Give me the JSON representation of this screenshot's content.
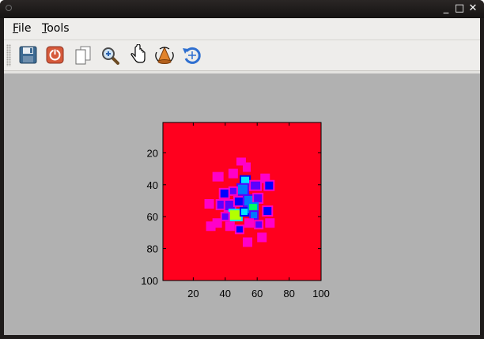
{
  "window": {
    "minimize_glyph": "_",
    "maximize_glyph": "□",
    "close_glyph": "✕"
  },
  "menubar": {
    "file": {
      "mnemonic": "F",
      "rest": "ile"
    },
    "tools": {
      "mnemonic": "T",
      "rest": "ools"
    }
  },
  "toolbar": {
    "buttons": [
      {
        "name": "save",
        "icon": "floppy-disk-icon"
      },
      {
        "name": "stop",
        "icon": "power-stop-icon"
      },
      {
        "name": "copy",
        "icon": "copy-pages-icon"
      },
      {
        "name": "zoom",
        "icon": "magnifier-icon"
      },
      {
        "name": "pan",
        "icon": "hand-pointer-icon"
      },
      {
        "name": "rotate",
        "icon": "rotate-3d-cone-icon"
      },
      {
        "name": "reset",
        "icon": "undo-arrow-icon"
      }
    ]
  },
  "chart_data": {
    "type": "heatmap",
    "title": "",
    "xlabel": "",
    "ylabel": "",
    "xlim": [
      1,
      100
    ],
    "ylim": [
      1,
      100
    ],
    "y_reversed": true,
    "x_ticks": [
      "20",
      "40",
      "60",
      "80",
      "100"
    ],
    "y_ticks": [
      "20",
      "40",
      "60",
      "80",
      "100"
    ],
    "x_tick_values": [
      20,
      40,
      60,
      80,
      100
    ],
    "y_tick_values": [
      20,
      40,
      60,
      80,
      100
    ],
    "background_color": "#ff001e",
    "colormap": [
      "#ff001e",
      "#ff00c8",
      "#5a00ff",
      "#0000ff",
      "#0078ff",
      "#00e6ff",
      "#00ff64",
      "#b4ff00"
    ],
    "blobs": [
      {
        "x": 48,
        "y": 24,
        "w": 4,
        "h": 3,
        "level": 1
      },
      {
        "x": 52,
        "y": 27,
        "w": 3,
        "h": 4,
        "level": 1
      },
      {
        "x": 33,
        "y": 33,
        "w": 5,
        "h": 4,
        "level": 1
      },
      {
        "x": 43,
        "y": 31,
        "w": 4,
        "h": 4,
        "level": 1
      },
      {
        "x": 50,
        "y": 35,
        "w": 5,
        "h": 5,
        "level": 5
      },
      {
        "x": 48,
        "y": 40,
        "w": 6,
        "h": 6,
        "level": 4
      },
      {
        "x": 43,
        "y": 42,
        "w": 4,
        "h": 4,
        "level": 2
      },
      {
        "x": 37,
        "y": 43,
        "w": 5,
        "h": 5,
        "level": 3
      },
      {
        "x": 56,
        "y": 38,
        "w": 6,
        "h": 5,
        "level": 2
      },
      {
        "x": 63,
        "y": 34,
        "w": 4,
        "h": 4,
        "level": 1
      },
      {
        "x": 65,
        "y": 38,
        "w": 5,
        "h": 5,
        "level": 3
      },
      {
        "x": 35,
        "y": 50,
        "w": 5,
        "h": 5,
        "level": 2
      },
      {
        "x": 40,
        "y": 50,
        "w": 6,
        "h": 6,
        "level": 2
      },
      {
        "x": 46,
        "y": 48,
        "w": 5,
        "h": 5,
        "level": 3
      },
      {
        "x": 52,
        "y": 47,
        "w": 6,
        "h": 6,
        "level": 4
      },
      {
        "x": 58,
        "y": 46,
        "w": 5,
        "h": 5,
        "level": 2
      },
      {
        "x": 28,
        "y": 50,
        "w": 4,
        "h": 4,
        "level": 1
      },
      {
        "x": 43,
        "y": 56,
        "w": 7,
        "h": 6,
        "level": 7
      },
      {
        "x": 50,
        "y": 55,
        "w": 4,
        "h": 4,
        "level": 5
      },
      {
        "x": 55,
        "y": 52,
        "w": 5,
        "h": 5,
        "level": 6
      },
      {
        "x": 56,
        "y": 57,
        "w": 4,
        "h": 4,
        "level": 4
      },
      {
        "x": 64,
        "y": 54,
        "w": 5,
        "h": 5,
        "level": 3
      },
      {
        "x": 38,
        "y": 58,
        "w": 4,
        "h": 4,
        "level": 2
      },
      {
        "x": 33,
        "y": 62,
        "w": 4,
        "h": 4,
        "level": 1
      },
      {
        "x": 29,
        "y": 64,
        "w": 4,
        "h": 4,
        "level": 1
      },
      {
        "x": 41,
        "y": 64,
        "w": 4,
        "h": 4,
        "level": 1
      },
      {
        "x": 47,
        "y": 66,
        "w": 4,
        "h": 4,
        "level": 3
      },
      {
        "x": 53,
        "y": 62,
        "w": 4,
        "h": 4,
        "level": 1
      },
      {
        "x": 59,
        "y": 63,
        "w": 4,
        "h": 4,
        "level": 2
      },
      {
        "x": 66,
        "y": 62,
        "w": 4,
        "h": 4,
        "level": 1
      },
      {
        "x": 61,
        "y": 71,
        "w": 4,
        "h": 4,
        "level": 1
      },
      {
        "x": 52,
        "y": 74,
        "w": 4,
        "h": 4,
        "level": 1
      }
    ]
  }
}
